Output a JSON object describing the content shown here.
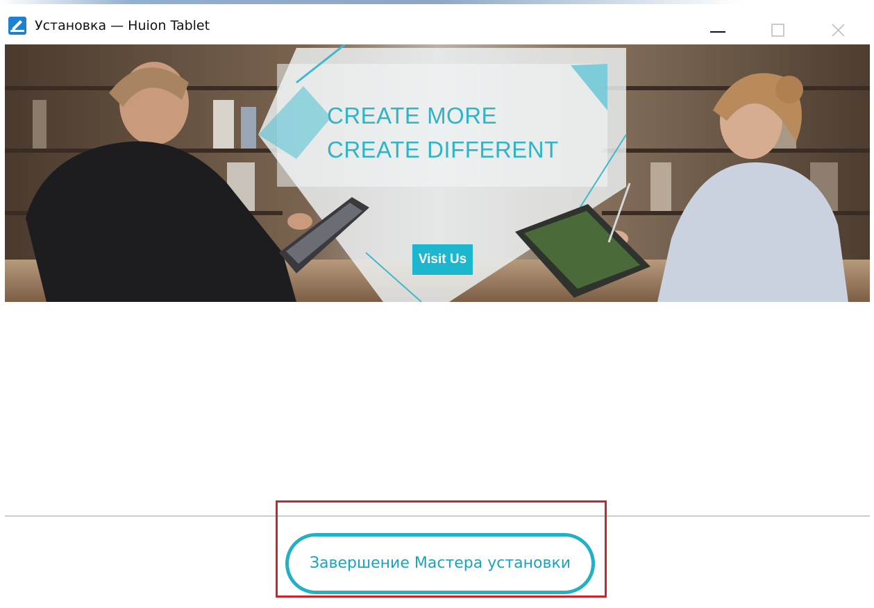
{
  "window": {
    "title": "Установка — Huion Tablet",
    "icon": "pen-tablet-icon",
    "controls": [
      "minimize-icon",
      "maximize-icon",
      "close-icon"
    ]
  },
  "banner": {
    "headline_line1": "CREATE MORE",
    "headline_line2": "CREATE DIFFERENT",
    "visit_button": "Visit Us",
    "accent_color": "#1cb6cf"
  },
  "footer": {
    "finish_button": "Завершение Мастера установки",
    "highlight_color": "#c8252c",
    "button_color": "#23b0c6"
  }
}
